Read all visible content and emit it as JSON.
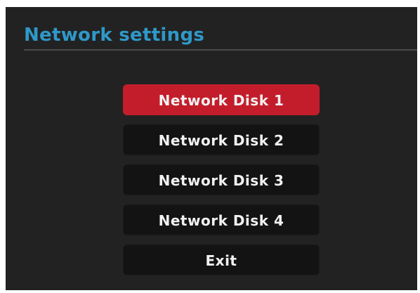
{
  "header": {
    "title": "Network settings"
  },
  "menu": {
    "items": [
      {
        "label": "Network Disk 1",
        "selected": true
      },
      {
        "label": "Network Disk 2",
        "selected": false
      },
      {
        "label": "Network Disk 3",
        "selected": false
      },
      {
        "label": "Network Disk 4",
        "selected": false
      },
      {
        "label": "Exit",
        "selected": false
      }
    ]
  },
  "colors": {
    "background": "#222222",
    "title": "#2f98c9",
    "selected": "#c31d2b",
    "item": "#131313",
    "text": "#f1f1f1"
  }
}
